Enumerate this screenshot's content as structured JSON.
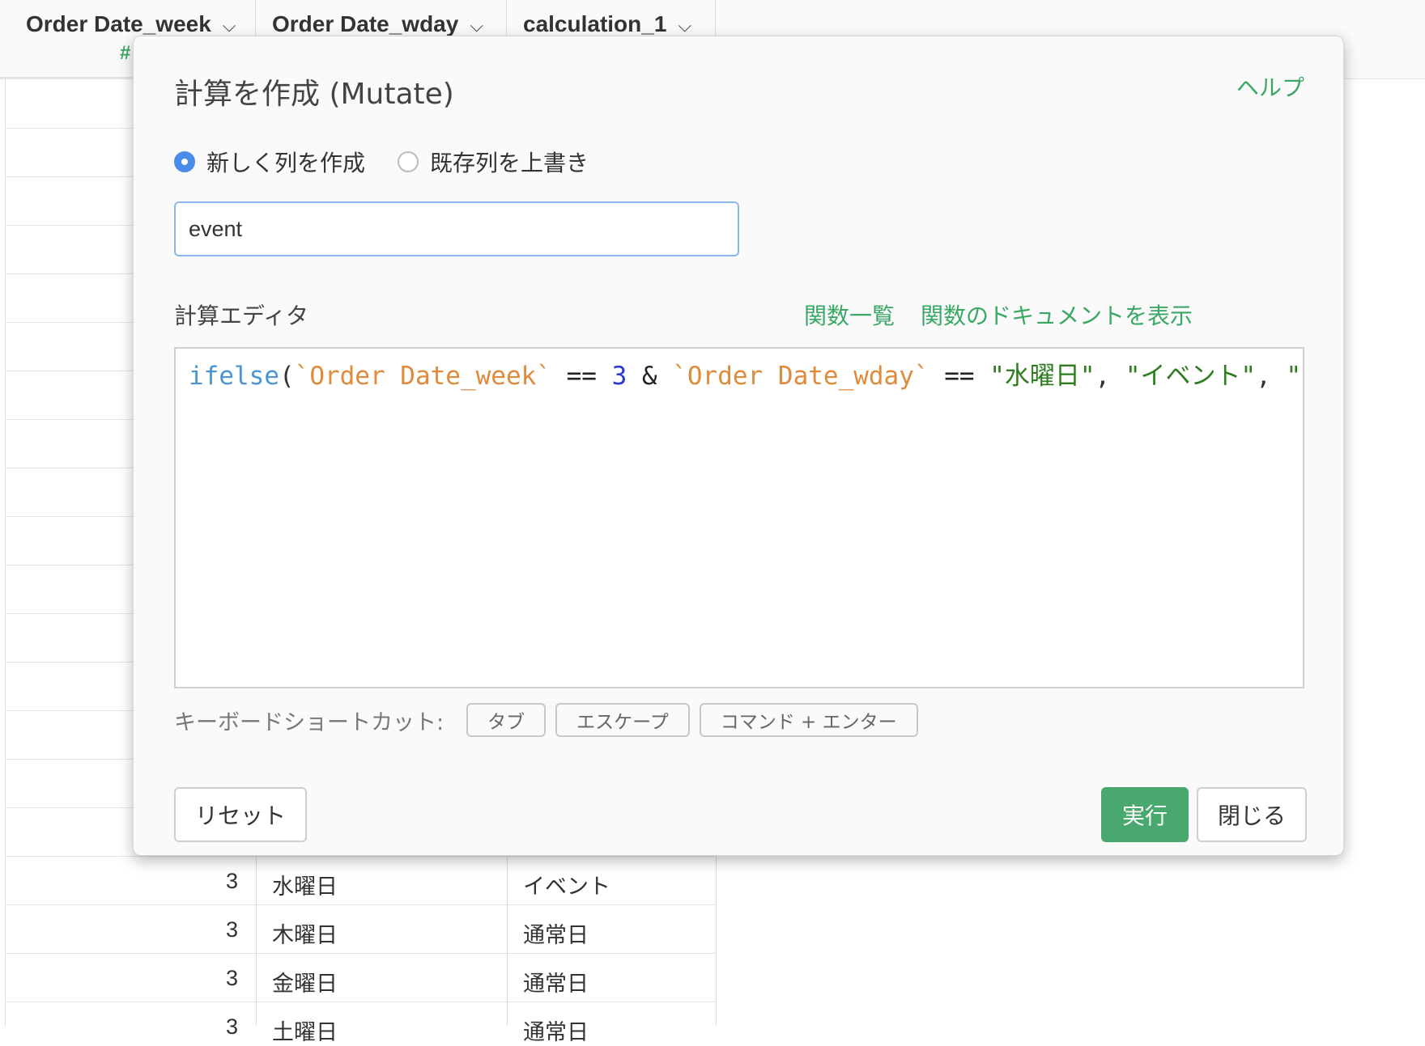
{
  "table": {
    "columns": [
      {
        "label": "Order Date_week",
        "type_icon": "#"
      },
      {
        "label": "Order Date_wday"
      },
      {
        "label": "calculation_1"
      }
    ],
    "rows": [
      {
        "week": "3",
        "wday": "水曜日",
        "calc": "イベント"
      },
      {
        "week": "3",
        "wday": "木曜日",
        "calc": "通常日"
      },
      {
        "week": "3",
        "wday": "金曜日",
        "calc": "通常日"
      },
      {
        "week": "3",
        "wday": "土曜日",
        "calc": "通常日"
      }
    ]
  },
  "modal": {
    "title": "計算を作成 (Mutate)",
    "help_link": "ヘルプ",
    "radio_new": "新しく列を作成",
    "radio_overwrite": "既存列を上書き",
    "column_name_value": "event",
    "editor_label": "計算エディタ",
    "functions_link": "関数一覧",
    "docs_link": "関数のドキュメントを表示",
    "code": {
      "fn": "ifelse",
      "p1": "(",
      "col1": "`Order Date_week`",
      "op1": " == ",
      "num": "3",
      "op2": " & ",
      "col2": "`Order Date_wday`",
      "op3": " == ",
      "str1": "\"水曜日\"",
      "sep1": ", ",
      "str2": "\"イベント\"",
      "sep2": ", ",
      "str3": "\""
    },
    "shortcut_label": "キーボードショートカット:",
    "shortcuts": [
      "タブ",
      "エスケープ",
      "コマンド + エンター"
    ],
    "reset_button": "リセット",
    "run_button": "実行",
    "close_button": "閉じる"
  },
  "colors": {
    "accent_green": "#3aa865",
    "run_button": "#49a86d",
    "focus_blue": "#8bb6ee",
    "radio_selected": "#4a8ae8"
  }
}
